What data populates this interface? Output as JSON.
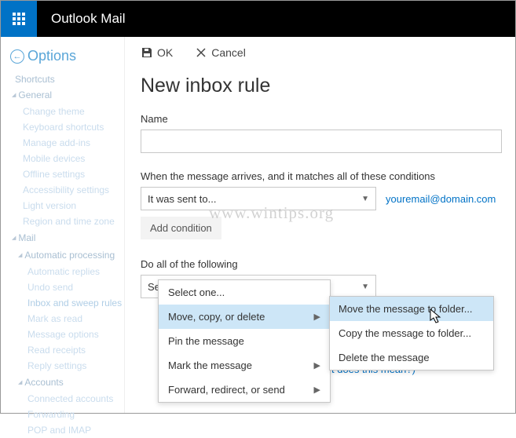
{
  "header": {
    "app_title": "Outlook Mail"
  },
  "sidebar": {
    "back_label": "Options",
    "shortcuts": "Shortcuts",
    "groups": [
      {
        "label": "General",
        "items": [
          "Change theme",
          "Keyboard shortcuts",
          "Manage add-ins",
          "Mobile devices",
          "Offline settings",
          "Accessibility settings",
          "Light version",
          "Region and time zone"
        ]
      },
      {
        "label": "Mail",
        "subgroups": [
          {
            "label": "Automatic processing",
            "items": [
              "Automatic replies",
              "Undo send",
              "Inbox and sweep rules",
              "Mark as read",
              "Message options",
              "Read receipts",
              "Reply settings"
            ]
          },
          {
            "label": "Accounts",
            "items": [
              "Connected accounts",
              "Forwarding",
              "POP and IMAP"
            ]
          }
        ]
      }
    ]
  },
  "toolbar": {
    "ok": "OK",
    "cancel": "Cancel"
  },
  "page": {
    "title": "New inbox rule",
    "name_label": "Name",
    "name_value": "",
    "conditions_label": "When the message arrives, and it matches all of these conditions",
    "condition1": "It was sent to...",
    "recipient": "youremail@domain.com",
    "add_condition": "Add condition",
    "actions_label": "Do all of the following",
    "action_select": "Select one..."
  },
  "menu1": {
    "items": [
      {
        "label": "Select one...",
        "sub": false,
        "hover": false
      },
      {
        "label": "Move, copy, or delete",
        "sub": true,
        "hover": true
      },
      {
        "label": "Pin the message",
        "sub": false,
        "hover": false
      },
      {
        "label": "Mark the message",
        "sub": true,
        "hover": false
      },
      {
        "label": "Forward, redirect, or send",
        "sub": true,
        "hover": false
      }
    ]
  },
  "menu2": {
    "items": [
      {
        "label": "Move the message to folder...",
        "hover": true
      },
      {
        "label": "Copy the message to folder...",
        "hover": false
      },
      {
        "label": "Delete the message",
        "hover": false
      }
    ]
  },
  "hint": "t does this mean?)",
  "watermark": "www.wintips.org"
}
